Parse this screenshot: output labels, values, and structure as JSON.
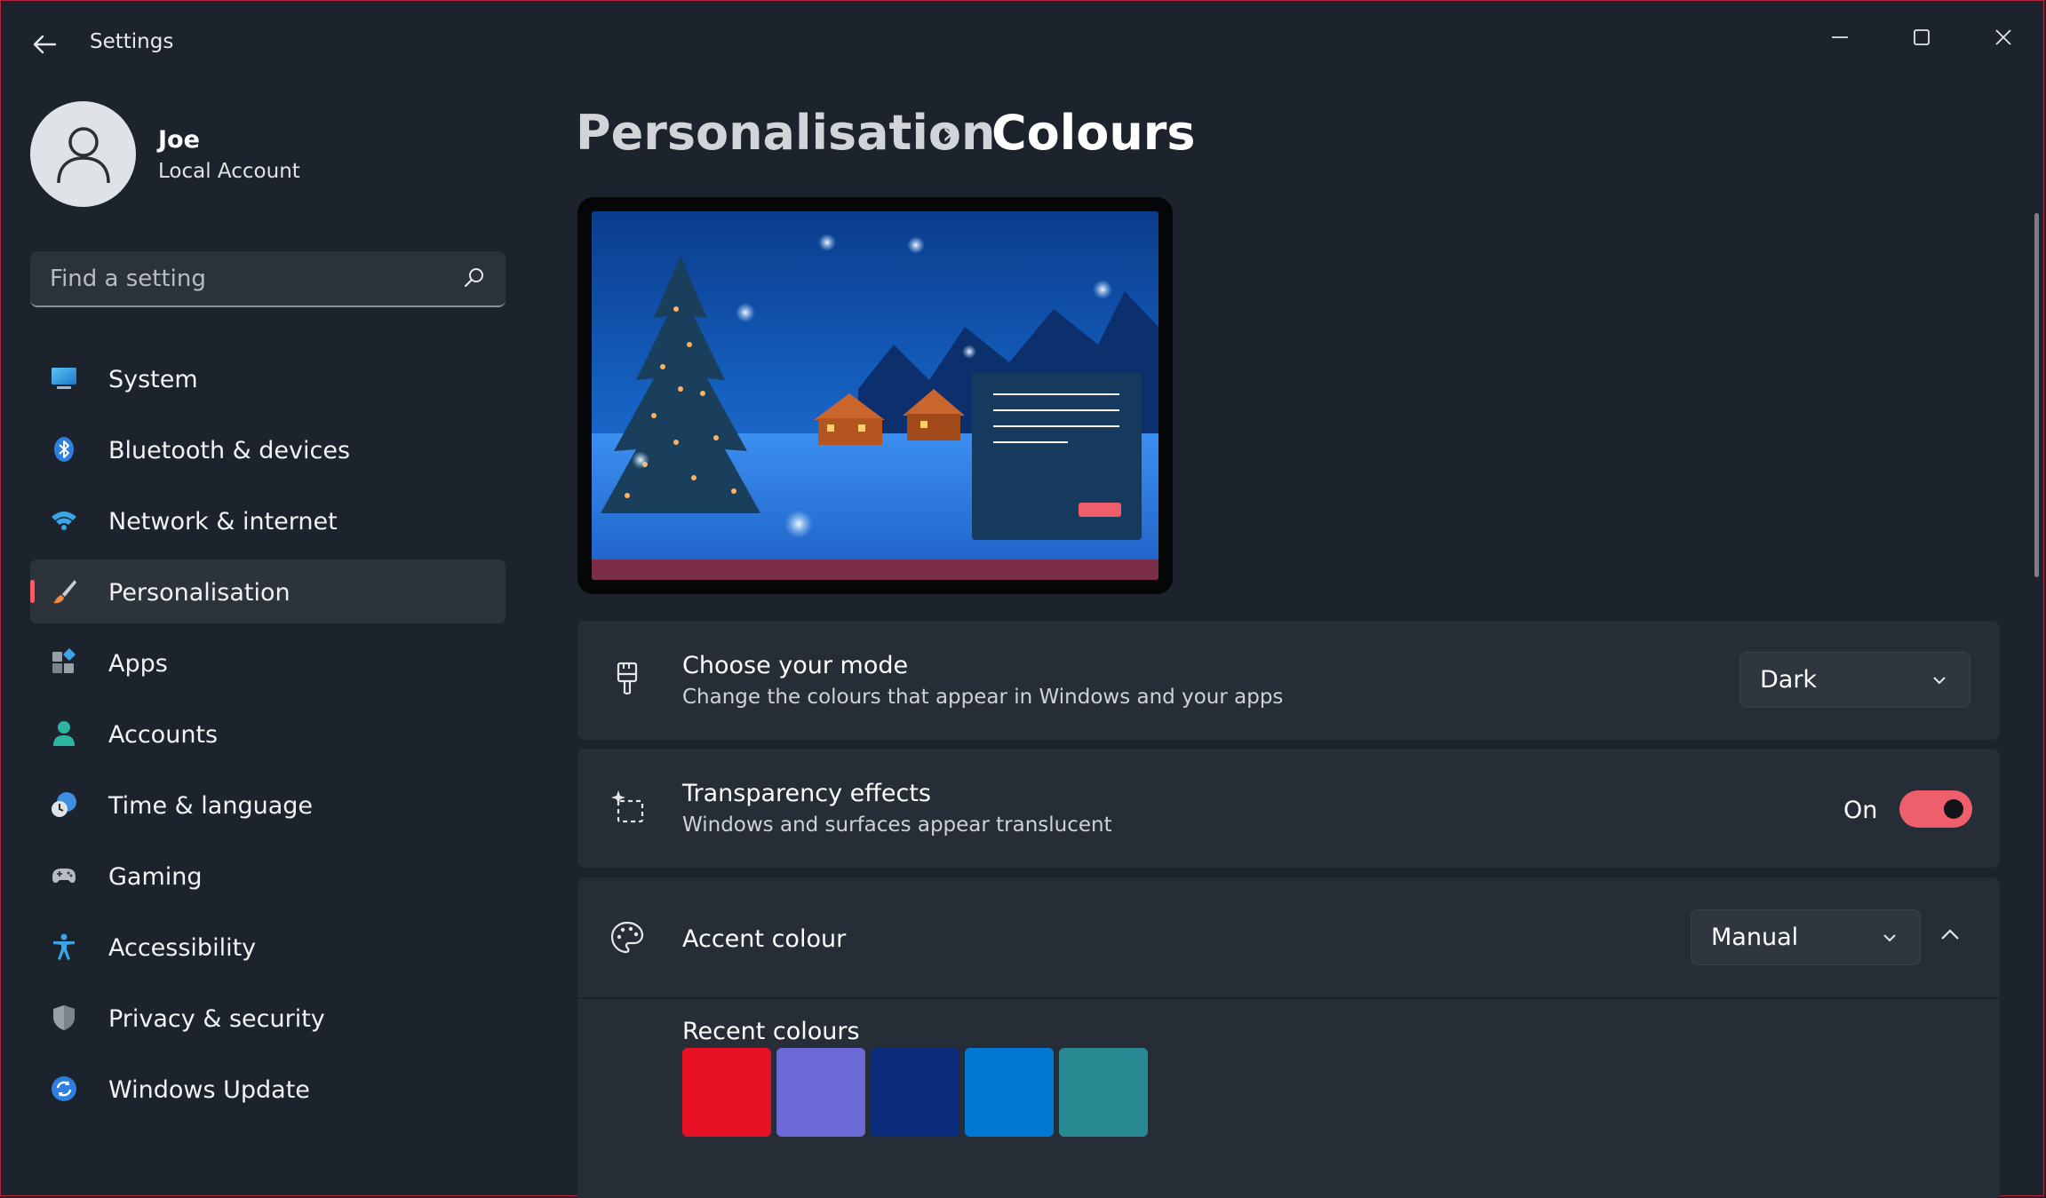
{
  "window": {
    "title": "Settings",
    "controls": [
      "minimize",
      "maximize",
      "close"
    ]
  },
  "user": {
    "name": "Joe",
    "account_type": "Local Account"
  },
  "search": {
    "placeholder": "Find a setting"
  },
  "sidebar": {
    "items": [
      {
        "label": "System",
        "icon": "monitor-icon"
      },
      {
        "label": "Bluetooth & devices",
        "icon": "bluetooth-icon"
      },
      {
        "label": "Network & internet",
        "icon": "wifi-icon"
      },
      {
        "label": "Personalisation",
        "icon": "paintbrush-icon",
        "selected": true
      },
      {
        "label": "Apps",
        "icon": "apps-icon"
      },
      {
        "label": "Accounts",
        "icon": "person-icon"
      },
      {
        "label": "Time & language",
        "icon": "clock-globe-icon"
      },
      {
        "label": "Gaming",
        "icon": "gamepad-icon"
      },
      {
        "label": "Accessibility",
        "icon": "accessibility-icon"
      },
      {
        "label": "Privacy & security",
        "icon": "shield-icon"
      },
      {
        "label": "Windows Update",
        "icon": "sync-icon"
      }
    ]
  },
  "breadcrumb": {
    "parent": "Personalisation",
    "separator": "›",
    "current": "Colours"
  },
  "mode": {
    "title": "Choose your mode",
    "subtitle": "Change the colours that appear in Windows and your apps",
    "value": "Dark",
    "icon": "paintbrush-mode-icon"
  },
  "transparency": {
    "title": "Transparency effects",
    "subtitle": "Windows and surfaces appear translucent",
    "state_label": "On",
    "enabled": true,
    "icon": "sparkle-icon"
  },
  "accent": {
    "title": "Accent colour",
    "value": "Manual",
    "icon": "palette-icon",
    "expanded": true,
    "recent_label": "Recent colours",
    "recent_colours": [
      "#e81123",
      "#6b69d6",
      "#0a2a7a",
      "#0078d4",
      "#2a8a94"
    ]
  },
  "theme": {
    "accent": "#ef5f6b",
    "background": "#1c232c",
    "card": "#262d36"
  }
}
